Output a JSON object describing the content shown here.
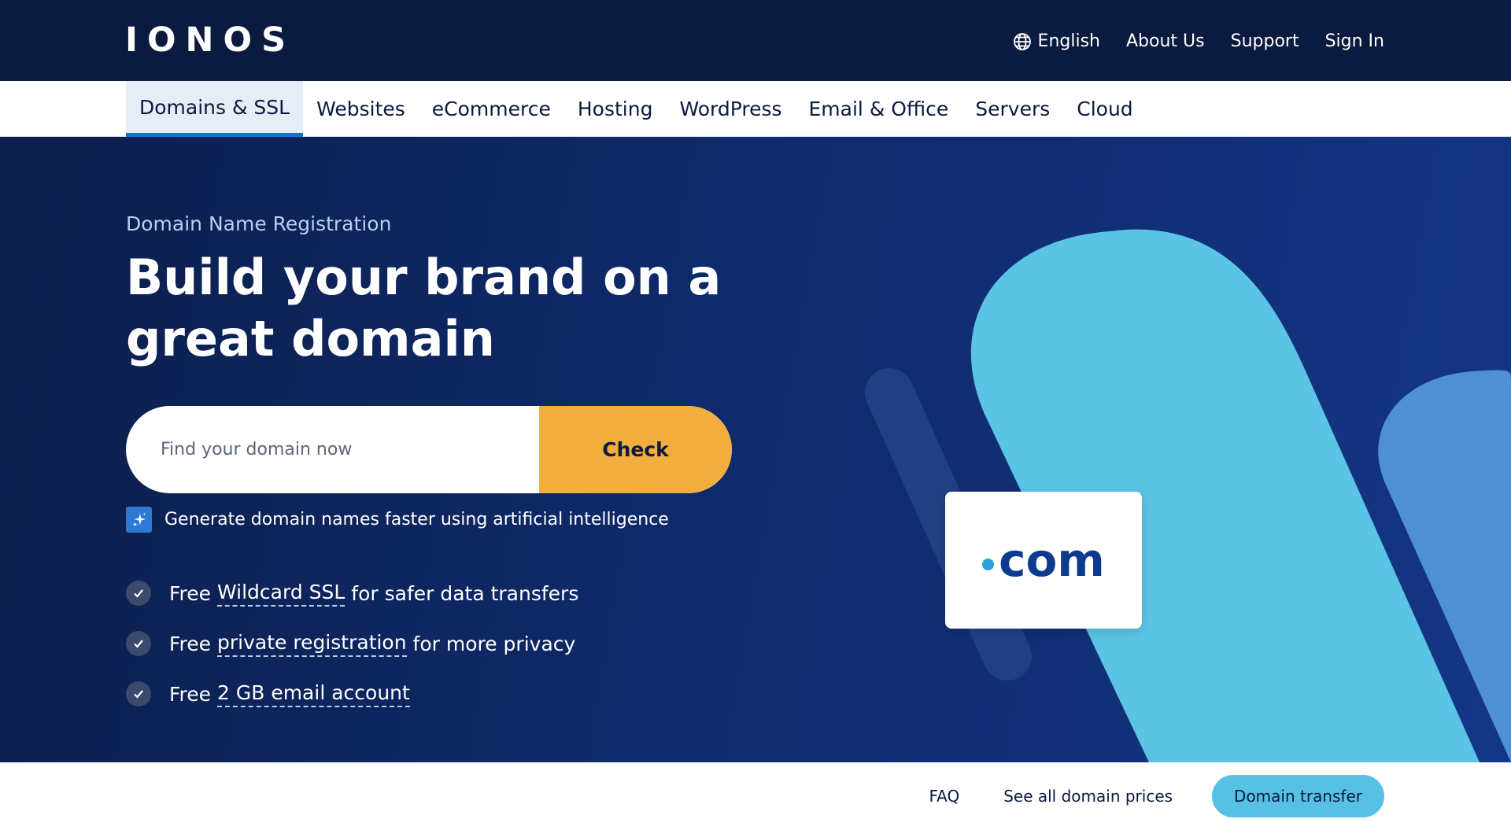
{
  "header": {
    "logo": "IONOS",
    "links": {
      "language": "English",
      "about": "About Us",
      "support": "Support",
      "signin": "Sign In"
    },
    "icons": {
      "language": "globe-icon"
    }
  },
  "nav": {
    "items": [
      "Domains & SSL",
      "Websites",
      "eCommerce",
      "Hosting",
      "WordPress",
      "Email & Office",
      "Servers",
      "Cloud"
    ],
    "active_index": 0
  },
  "hero": {
    "eyebrow": "Domain Name Registration",
    "headline": "Build your brand on a great domain",
    "search": {
      "placeholder": "Find your domain now",
      "button": "Check"
    },
    "ai_link": "Generate domain names faster using artificial intelligence",
    "features": [
      {
        "prefix": "Free ",
        "link": "Wildcard SSL",
        "suffix": " for safer data transfers"
      },
      {
        "prefix": "Free ",
        "link": "private registration",
        "suffix": " for more privacy"
      },
      {
        "prefix": "Free ",
        "link": "2 GB email account",
        "suffix": ""
      }
    ],
    "card_tld": "com"
  },
  "bottom": {
    "faq": "FAQ",
    "prices": "See all domain prices",
    "transfer": "Domain transfer"
  },
  "colors": {
    "topbar": "#0b1a3f",
    "hero": "#0f2a6a",
    "accent_orange": "#f1ad3d",
    "light_blue": "#5bc4e4",
    "button_blue": "#56c1e4"
  }
}
